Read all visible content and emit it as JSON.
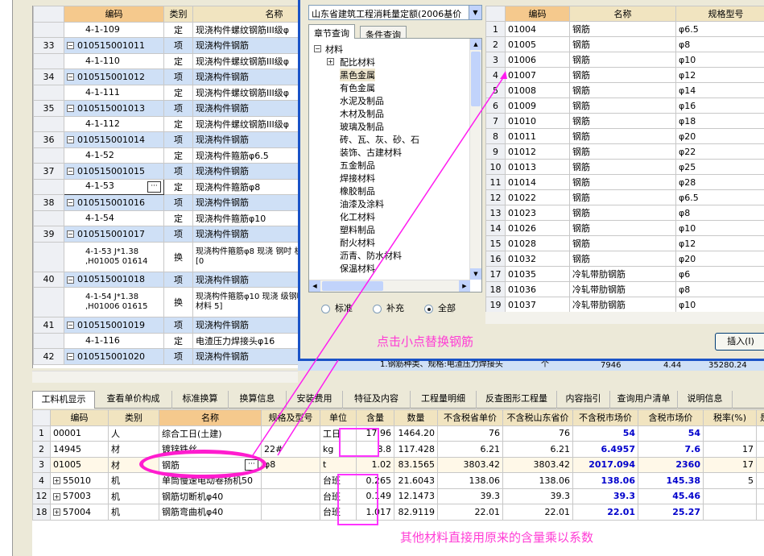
{
  "top_grid": {
    "headers": [
      "编码",
      "类别",
      "名称"
    ],
    "rows": [
      {
        "no": "",
        "code": "4-1-109",
        "type": "定",
        "name": "现浇构件螺纹钢筋III级φ",
        "parent": false
      },
      {
        "no": "33",
        "code": "010515001011",
        "type": "项",
        "name": "现浇构件钢筋",
        "parent": true
      },
      {
        "no": "",
        "code": "4-1-110",
        "type": "定",
        "name": "现浇构件螺纹钢筋III级φ",
        "parent": false
      },
      {
        "no": "34",
        "code": "010515001012",
        "type": "项",
        "name": "现浇构件钢筋",
        "parent": true
      },
      {
        "no": "",
        "code": "4-1-111",
        "type": "定",
        "name": "现浇构件螺纹钢筋III级φ",
        "parent": false
      },
      {
        "no": "35",
        "code": "010515001013",
        "type": "项",
        "name": "现浇构件钢筋",
        "parent": true
      },
      {
        "no": "",
        "code": "4-1-112",
        "type": "定",
        "name": "现浇构件螺纹钢筋III级φ",
        "parent": false
      },
      {
        "no": "36",
        "code": "010515001014",
        "type": "项",
        "name": "现浇构件钢筋",
        "parent": true
      },
      {
        "no": "",
        "code": "4-1-52",
        "type": "定",
        "name": "现浇构件箍筋φ6.5",
        "parent": false
      },
      {
        "no": "37",
        "code": "010515001015",
        "type": "项",
        "name": "现浇构件钢筋",
        "parent": true
      },
      {
        "no": "",
        "code": "4-1-53",
        "type": "定",
        "name": "现浇构件箍筋φ8",
        "parent": false,
        "selected": true
      },
      {
        "no": "38",
        "code": "010515001016",
        "type": "项",
        "name": "现浇构件钢筋",
        "parent": true
      },
      {
        "no": "",
        "code": "4-1-54",
        "type": "定",
        "name": "现浇构件箍筋φ10",
        "parent": false
      },
      {
        "no": "39",
        "code": "010515001017",
        "type": "项",
        "name": "现浇构件钢筋",
        "parent": true
      },
      {
        "no": "",
        "code": "4-1-53 J*1.38 ,H01005 01614",
        "type": "换",
        "name": "现浇构件箍筋φ8 现浇 钢吋 机械*1.38,材料[0",
        "parent": false,
        "tall": true
      },
      {
        "no": "40",
        "code": "010515001018",
        "type": "项",
        "name": "现浇构件钢筋",
        "parent": true
      },
      {
        "no": "",
        "code": "4-1-54 J*1.38 ,H01006 01615",
        "type": "换",
        "name": "现浇构件箍筋φ10 现浇 级钢吋 机械*1.38,材料 5]",
        "parent": false,
        "tall": true
      },
      {
        "no": "41",
        "code": "010515001019",
        "type": "项",
        "name": "现浇构件钢筋",
        "parent": true
      },
      {
        "no": "",
        "code": "4-1-116",
        "type": "定",
        "name": "电渣压力焊接头φ16",
        "parent": false
      },
      {
        "no": "42",
        "code": "010515001020",
        "type": "项",
        "name": "现浇构件钢筋",
        "parent": true
      }
    ]
  },
  "dialog": {
    "db_select": "山东省建筑工程消耗量定额(2006基价",
    "tabs": [
      "章节查询",
      "条件查询"
    ],
    "tree": {
      "root": "材料",
      "items": [
        "配比材料",
        "黑色金属",
        "有色金属",
        "水泥及制品",
        "木材及制品",
        "玻璃及制品",
        "砖、瓦、灰、砂、石",
        "装饰、古建材料",
        "五金制品",
        "焊接材料",
        "橡胶制品",
        "油漆及涂料",
        "化工材料",
        "塑料制品",
        "耐火材料",
        "沥青、防水材料",
        "保温材料"
      ]
    },
    "radios": [
      "标准",
      "补充",
      "全部"
    ],
    "grid_headers": [
      "编码",
      "名称",
      "规格型号"
    ],
    "grid_rows": [
      [
        "1",
        "01004",
        "钢筋",
        "φ6.5"
      ],
      [
        "2",
        "01005",
        "钢筋",
        "φ8"
      ],
      [
        "3",
        "01006",
        "钢筋",
        "φ10"
      ],
      [
        "4",
        "01007",
        "钢筋",
        "φ12"
      ],
      [
        "5",
        "01008",
        "钢筋",
        "φ14"
      ],
      [
        "6",
        "01009",
        "钢筋",
        "φ16"
      ],
      [
        "7",
        "01010",
        "钢筋",
        "φ18"
      ],
      [
        "8",
        "01011",
        "钢筋",
        "φ20"
      ],
      [
        "9",
        "01012",
        "钢筋",
        "φ22"
      ],
      [
        "10",
        "01013",
        "钢筋",
        "φ25"
      ],
      [
        "11",
        "01014",
        "钢筋",
        "φ28"
      ],
      [
        "12",
        "01022",
        "钢筋",
        "φ6.5"
      ],
      [
        "13",
        "01023",
        "钢筋",
        "φ8"
      ],
      [
        "14",
        "01026",
        "钢筋",
        "φ10"
      ],
      [
        "15",
        "01028",
        "钢筋",
        "φ12"
      ],
      [
        "16",
        "01032",
        "钢筋",
        "φ20"
      ],
      [
        "17",
        "01035",
        "冷轧带肋钢筋",
        "φ6"
      ],
      [
        "18",
        "01036",
        "冷轧带肋钢筋",
        "φ8"
      ],
      [
        "19",
        "01037",
        "冷轧带肋钢筋",
        "φ10"
      ]
    ],
    "insert_button": "插入(I)"
  },
  "bottom_tabs": [
    "工料机显示",
    "查看单价构成",
    "标准换算",
    "换算信息",
    "安装费用",
    "特征及内容",
    "工程量明细",
    "反查图形工程量",
    "内容指引",
    "查询用户清单",
    "说明信息"
  ],
  "bottom_grid": {
    "headers": [
      "",
      "编码",
      "类别",
      "名称",
      "规格及型号",
      "单位",
      "含量",
      "数量",
      "不含税省单价",
      "不含税山东省价",
      "不含税市场价",
      "含税市场价",
      "税率(%)",
      "是否"
    ],
    "rows": [
      [
        "1",
        "00001",
        "人",
        "综合工日(土建)",
        "",
        "工日",
        "17.96",
        "1464.20",
        "76",
        "76",
        "54",
        "54",
        "",
        ""
      ],
      [
        "2",
        "14945",
        "材",
        "镀锌铁丝",
        "22#",
        "kg",
        "8.8",
        "117.428",
        "6.21",
        "6.21",
        "6.4957",
        "7.6",
        "17",
        ""
      ],
      [
        "3",
        "01005",
        "材",
        "钢筋",
        "φ8",
        "t",
        "1.02",
        "83.1565",
        "3803.42",
        "3803.42",
        "2017.094",
        "2360",
        "17",
        ""
      ],
      [
        "4",
        "55010",
        "机",
        "单筒慢速电动卷扬机50",
        "",
        "台班",
        "0.265",
        "21.6043",
        "138.06",
        "138.06",
        "138.06",
        "145.38",
        "5",
        ""
      ],
      [
        "12",
        "57003",
        "机",
        "钢筋切断机φ40",
        "",
        "台班",
        "0.149",
        "12.1473",
        "39.3",
        "39.3",
        "39.3",
        "45.46",
        "",
        ""
      ],
      [
        "18",
        "57004",
        "机",
        "钢筋弯曲机φ40",
        "",
        "台班",
        "1.017",
        "82.9119",
        "22.01",
        "22.01",
        "22.01",
        "25.27",
        "",
        ""
      ]
    ]
  },
  "partial_row": {
    "name": "1.钢筋种类、规格:电渣压力焊接头",
    "unit": "个",
    "qty": "7946",
    "price": "4.44",
    "total": "35280.24"
  },
  "annotations": {
    "click_dot": "点击小点替换钢筋",
    "other_materials": "其他材料直接用原来的含量乘以系数"
  }
}
